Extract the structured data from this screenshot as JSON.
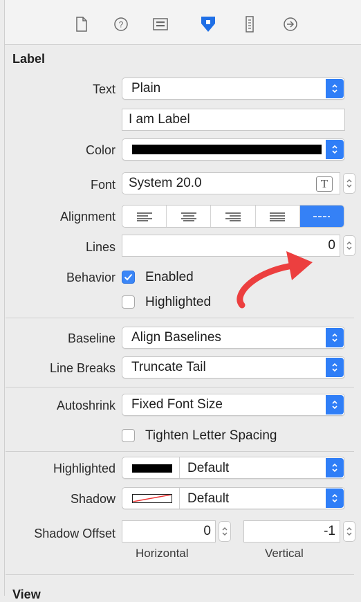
{
  "toolbar": {
    "icons": [
      "file-inspector-icon",
      "quick-help-icon",
      "identity-inspector-icon",
      "attributes-inspector-icon",
      "size-inspector-icon",
      "connections-inspector-icon"
    ]
  },
  "section": {
    "title": "Label",
    "next_title": "View"
  },
  "text": {
    "label": "Text",
    "type_value": "Plain",
    "content_value": "I am Label"
  },
  "color": {
    "label": "Color",
    "swatch": "#000000"
  },
  "font": {
    "label": "Font",
    "value": "System 20.0",
    "button_glyph": "T"
  },
  "alignment": {
    "label": "Alignment",
    "selected_index": 4
  },
  "lines": {
    "label": "Lines",
    "value": "0"
  },
  "behavior": {
    "label": "Behavior",
    "enabled_label": "Enabled",
    "enabled_checked": true,
    "highlighted_label": "Highlighted",
    "highlighted_checked": false
  },
  "baseline": {
    "label": "Baseline",
    "value": "Align Baselines"
  },
  "line_breaks": {
    "label": "Line Breaks",
    "value": "Truncate Tail"
  },
  "autoshrink": {
    "label": "Autoshrink",
    "value": "Fixed Font Size",
    "tighten_label": "Tighten Letter Spacing",
    "tighten_checked": false
  },
  "highlighted": {
    "label": "Highlighted",
    "value": "Default",
    "swatch": "#000000"
  },
  "shadow": {
    "label": "Shadow",
    "value": "Default"
  },
  "shadow_offset": {
    "label": "Shadow Offset",
    "horizontal_value": "0",
    "vertical_value": "-1",
    "horizontal_label": "Horizontal",
    "vertical_label": "Vertical"
  },
  "colors": {
    "accent": "#2f7ef7",
    "annotation_arrow": "#ec3f3f"
  }
}
